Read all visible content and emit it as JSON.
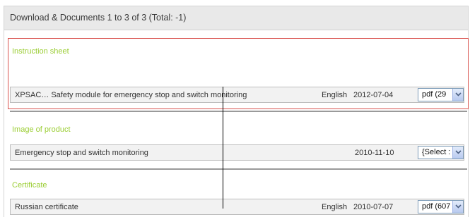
{
  "header": {
    "title": "Download & Documents 1 to 3 of 3 (Total: -1)"
  },
  "sections": [
    {
      "title": "Instruction sheet",
      "document": {
        "name": "XPSAC… Safety module for emergency stop and switch monitoring",
        "language": "English",
        "date": "2012-07-04",
        "select_value": "pdf (29"
      }
    },
    {
      "title": "Image of product",
      "document": {
        "name": "Emergency stop and switch monitoring",
        "language": "",
        "date": "2010-11-10",
        "select_value": "{Select :"
      }
    },
    {
      "title": "Certificate",
      "document": {
        "name": "Russian certificate",
        "language": "English",
        "date": "2010-07-07",
        "select_value": "pdf (607"
      }
    }
  ],
  "colors": {
    "section_title": "#9acd32",
    "highlight_border": "#d9534f",
    "header_bg": "#e9e9e9",
    "row_bg": "#f2f2f2"
  },
  "icons": {
    "dropdown": "chevron-down-icon"
  }
}
